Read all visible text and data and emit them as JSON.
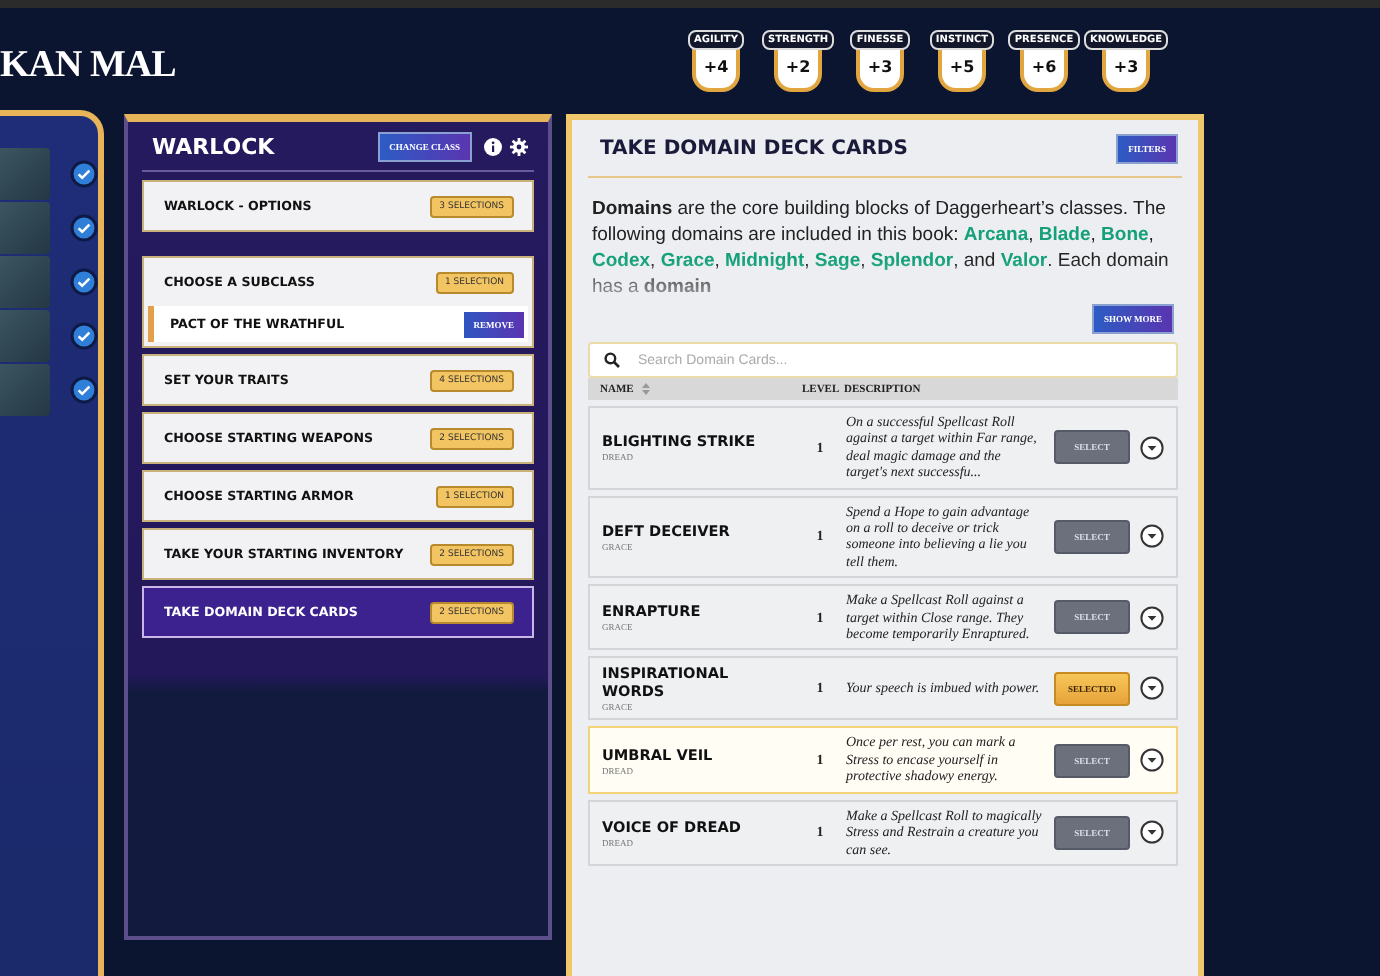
{
  "character": {
    "name": "KAN MAL"
  },
  "traits": [
    {
      "label": "AGILITY",
      "value": "+4"
    },
    {
      "label": "STRENGTH",
      "value": "+2"
    },
    {
      "label": "FINESSE",
      "value": "+3"
    },
    {
      "label": "INSTINCT",
      "value": "+5"
    },
    {
      "label": "PRESENCE",
      "value": "+6"
    },
    {
      "label": "KNOWLEDGE",
      "value": "+3"
    }
  ],
  "steps": [
    {
      "checked": true
    },
    {
      "checked": true
    },
    {
      "checked": true
    },
    {
      "checked": true
    },
    {
      "checked": true
    }
  ],
  "class_panel": {
    "title": "WARLOCK",
    "change_button": "CHANGE CLASS",
    "sections": [
      {
        "title": "WARLOCK - OPTIONS",
        "badge": "3 SELECTIONS",
        "selected": false
      },
      {
        "title": "CHOOSE A SUBCLASS",
        "badge": "1 SELECTION",
        "selected": false,
        "choice": {
          "name": "PACT OF THE WRATHFUL",
          "button": "REMOVE"
        }
      },
      {
        "title": "SET YOUR TRAITS",
        "badge": "4 SELECTIONS",
        "selected": false
      },
      {
        "title": "CHOOSE STARTING WEAPONS",
        "badge": "2 SELECTIONS",
        "selected": false
      },
      {
        "title": "CHOOSE STARTING ARMOR",
        "badge": "1 SELECTION",
        "selected": false
      },
      {
        "title": "TAKE YOUR STARTING INVENTORY",
        "badge": "2 SELECTIONS",
        "selected": false
      },
      {
        "title": "TAKE DOMAIN DECK CARDS",
        "badge": "2 SELECTIONS",
        "selected": true
      }
    ]
  },
  "domain_panel": {
    "title": "TAKE DOMAIN DECK CARDS",
    "filters_button": "FILTERS",
    "intro": [
      {
        "text": "Domains",
        "kind": "bold"
      },
      {
        "text": " are the core building blocks of Daggerheart’s classes. The following domains are included in this book: ",
        "kind": "plain"
      },
      {
        "text": "Arcana",
        "kind": "domain"
      },
      {
        "text": ", ",
        "kind": "plain"
      },
      {
        "text": "Blade",
        "kind": "domain"
      },
      {
        "text": ", ",
        "kind": "plain"
      },
      {
        "text": "Bone",
        "kind": "domain"
      },
      {
        "text": ", ",
        "kind": "plain"
      },
      {
        "text": "Codex",
        "kind": "domain"
      },
      {
        "text": ", ",
        "kind": "plain"
      },
      {
        "text": "Grace",
        "kind": "domain"
      },
      {
        "text": ", ",
        "kind": "plain"
      },
      {
        "text": "Midnight",
        "kind": "domain"
      },
      {
        "text": ", ",
        "kind": "plain"
      },
      {
        "text": "Sage",
        "kind": "domain"
      },
      {
        "text": ", ",
        "kind": "plain"
      },
      {
        "text": "Splendor",
        "kind": "domain"
      },
      {
        "text": ", and ",
        "kind": "plain"
      },
      {
        "text": "Valor",
        "kind": "domain"
      },
      {
        "text": ". Each domain has a ",
        "kind": "plain"
      },
      {
        "text": "domain",
        "kind": "bold"
      }
    ],
    "show_more_button": "SHOW MORE",
    "search": {
      "placeholder": "Search Domain Cards..."
    },
    "columns": [
      "NAME",
      "LEVEL",
      "DESCRIPTION"
    ],
    "cards": [
      {
        "name": "BLIGHTING STRIKE",
        "domain": "DREAD",
        "level": "1",
        "description": "On a successful Spellcast Roll against a target within Far range, deal magic damage and the target's next successfu...",
        "button": "SELECT",
        "selected": false,
        "hovered": false
      },
      {
        "name": "DEFT DECEIVER",
        "domain": "GRACE",
        "level": "1",
        "description": "Spend a Hope to gain advantage on a roll to deceive or trick someone into believing a lie you tell them.",
        "button": "SELECT",
        "selected": false,
        "hovered": false
      },
      {
        "name": "ENRAPTURE",
        "domain": "GRACE",
        "level": "1",
        "description": "Make a Spellcast Roll against a target within Close range. They become temporarily Enraptured.",
        "button": "SELECT",
        "selected": false,
        "hovered": false
      },
      {
        "name": "INSPIRATIONAL WORDS",
        "domain": "GRACE",
        "level": "1",
        "description": "Your speech is imbued with power.",
        "button": "SELECTED",
        "selected": true,
        "hovered": false
      },
      {
        "name": "UMBRAL VEIL",
        "domain": "DREAD",
        "level": "1",
        "description": "Once per rest, you can mark a Stress to encase yourself in protective shadowy energy.",
        "button": "SELECT",
        "selected": false,
        "hovered": true
      },
      {
        "name": "VOICE OF DREAD",
        "domain": "DREAD",
        "level": "1",
        "description": "Make a Spellcast Roll to magically Stress and Restrain a creature you can see.",
        "button": "SELECT",
        "selected": false,
        "hovered": false
      }
    ]
  }
}
